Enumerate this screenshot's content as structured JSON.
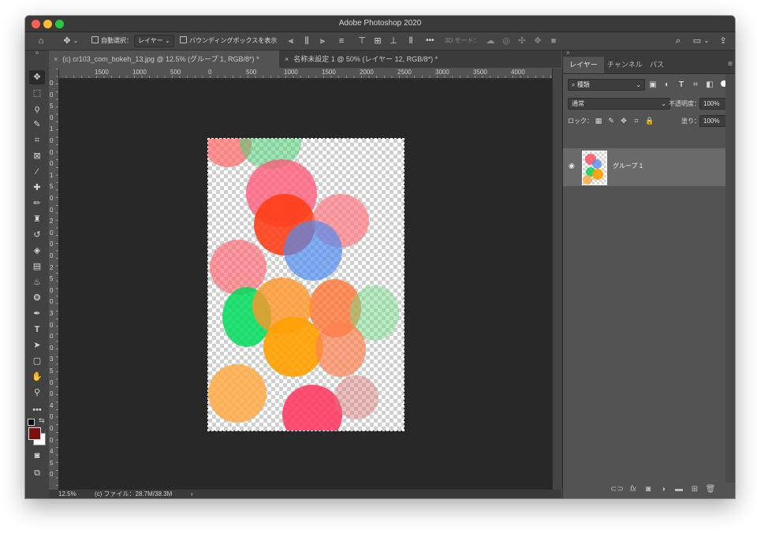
{
  "window": {
    "title": "Adobe Photoshop 2020"
  },
  "options_bar": {
    "auto_select_label": "自動選択：",
    "auto_select_target": "レイヤー",
    "bounding_box_label": "バウンディングボックスを表示",
    "more_label": "•••",
    "mode_3d_label": "3D モード："
  },
  "tabs": [
    {
      "close": "×",
      "label": "(c) cr103_com_bokeh_13.jpg @ 12.5% (グループ 1, RGB/8*) *",
      "active": true
    },
    {
      "close": "×",
      "label": "名称未設定 1 @ 50% (レイヤー 12, RGB/8*) *",
      "active": false
    }
  ],
  "ruler_top_labels": [
    "1500",
    "1000",
    "500",
    "0",
    "500",
    "1000",
    "1500",
    "2000",
    "2500",
    "3000",
    "3500",
    "4000"
  ],
  "ruler_left_labels": [
    "0",
    "0",
    "5",
    "0",
    "1",
    "0",
    "0",
    "0",
    "1",
    "5",
    "0",
    "0",
    "2",
    "0",
    "0",
    "0",
    "2",
    "5",
    "0",
    "0",
    "3",
    "0",
    "0",
    "0",
    "3",
    "5",
    "0",
    "0",
    "4",
    "0",
    "0",
    "0",
    "4",
    "5",
    "0"
  ],
  "status_bar": {
    "zoom": "12.5%",
    "file_info": "(c) ファイル：28.7M/38.3M",
    "arrow": "›"
  },
  "layers_panel": {
    "tabs": [
      "レイヤー",
      "チャンネル",
      "パス"
    ],
    "filter_label": "種類",
    "blend_mode": "通常",
    "opacity_label": "不透明度：",
    "opacity_value": "100%",
    "lock_label": "ロック：",
    "fill_label": "塗り：",
    "fill_value": "100%",
    "layers": [
      {
        "name": "グループ 1",
        "visible": true
      }
    ]
  },
  "colors": {
    "foreground": "#7a0f0f",
    "background": "#ffffff",
    "selected_layer": "#6a6a6a"
  },
  "icons": {
    "toolbar": [
      "move-icon",
      "marquee-icon",
      "lasso-icon",
      "quick-select-icon",
      "crop-icon",
      "frame-icon",
      "eyedropper-icon",
      "healing-brush-icon",
      "brush-icon",
      "stamp-icon",
      "history-brush-icon",
      "eraser-icon",
      "gradient-icon",
      "blur-icon",
      "dodge-icon",
      "pen-icon",
      "type-icon",
      "path-select-icon",
      "shape-icon",
      "hand-icon",
      "zoom-icon",
      "more-tools-icon"
    ]
  }
}
